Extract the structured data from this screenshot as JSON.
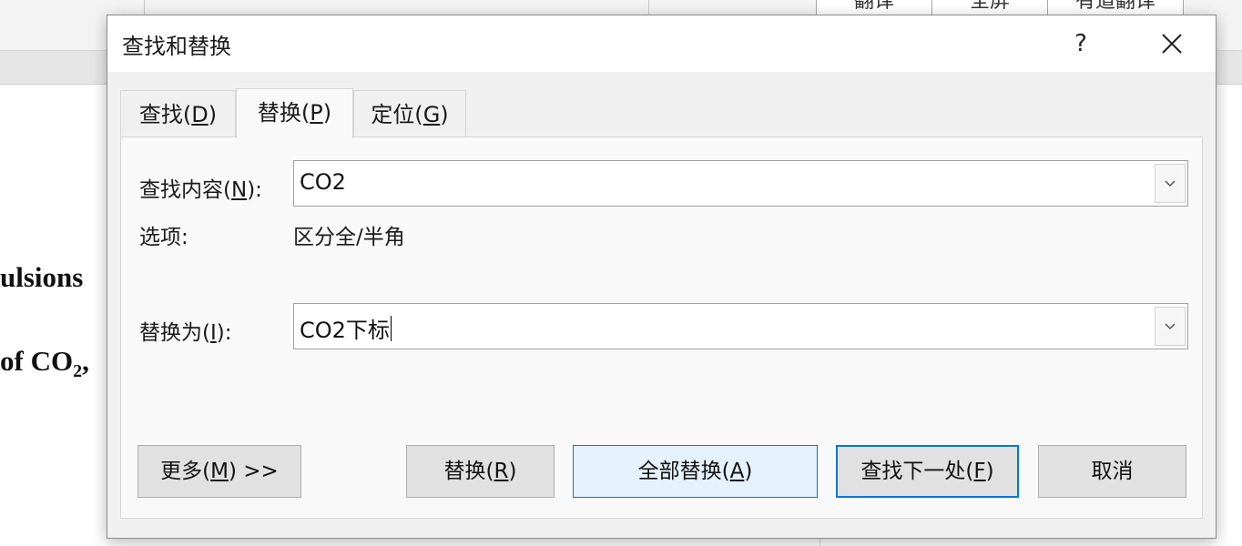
{
  "background": {
    "ribbon_buttons": [
      "翻译",
      "全屏",
      "有道翻译"
    ],
    "doc_lines": [
      "ulsions",
      "of CO",
      "2",
      ","
    ]
  },
  "dialog": {
    "title": "查找和替换",
    "help_label": "?",
    "close_icon": "close-icon",
    "tabs": [
      {
        "label": "查找(",
        "key": "D",
        "suffix": ")",
        "active": false
      },
      {
        "label": "替换(",
        "key": "P",
        "suffix": ")",
        "active": true
      },
      {
        "label": "定位(",
        "key": "G",
        "suffix": ")",
        "active": false
      }
    ],
    "find": {
      "label": "查找内容(",
      "key": "N",
      "suffix": "):",
      "value": "CO2"
    },
    "options": {
      "label": "选项:",
      "value": "区分全/半角"
    },
    "replace": {
      "label": "替换为(",
      "key": "I",
      "suffix": "):",
      "value": "CO2下标"
    },
    "buttons": {
      "more": {
        "label": "更多(",
        "key": "M",
        "suffix": ") >>"
      },
      "replace": {
        "label": "替换(",
        "key": "R",
        "suffix": ")"
      },
      "replace_all": {
        "label": "全部替换(",
        "key": "A",
        "suffix": ")"
      },
      "find_next": {
        "label": "查找下一处(",
        "key": "F",
        "suffix": ")"
      },
      "cancel": {
        "label": "取消"
      }
    },
    "colors": {
      "accent": "#0078d7",
      "hover_fill": "#e5f1fb",
      "button_face": "#e1e1e1"
    }
  }
}
